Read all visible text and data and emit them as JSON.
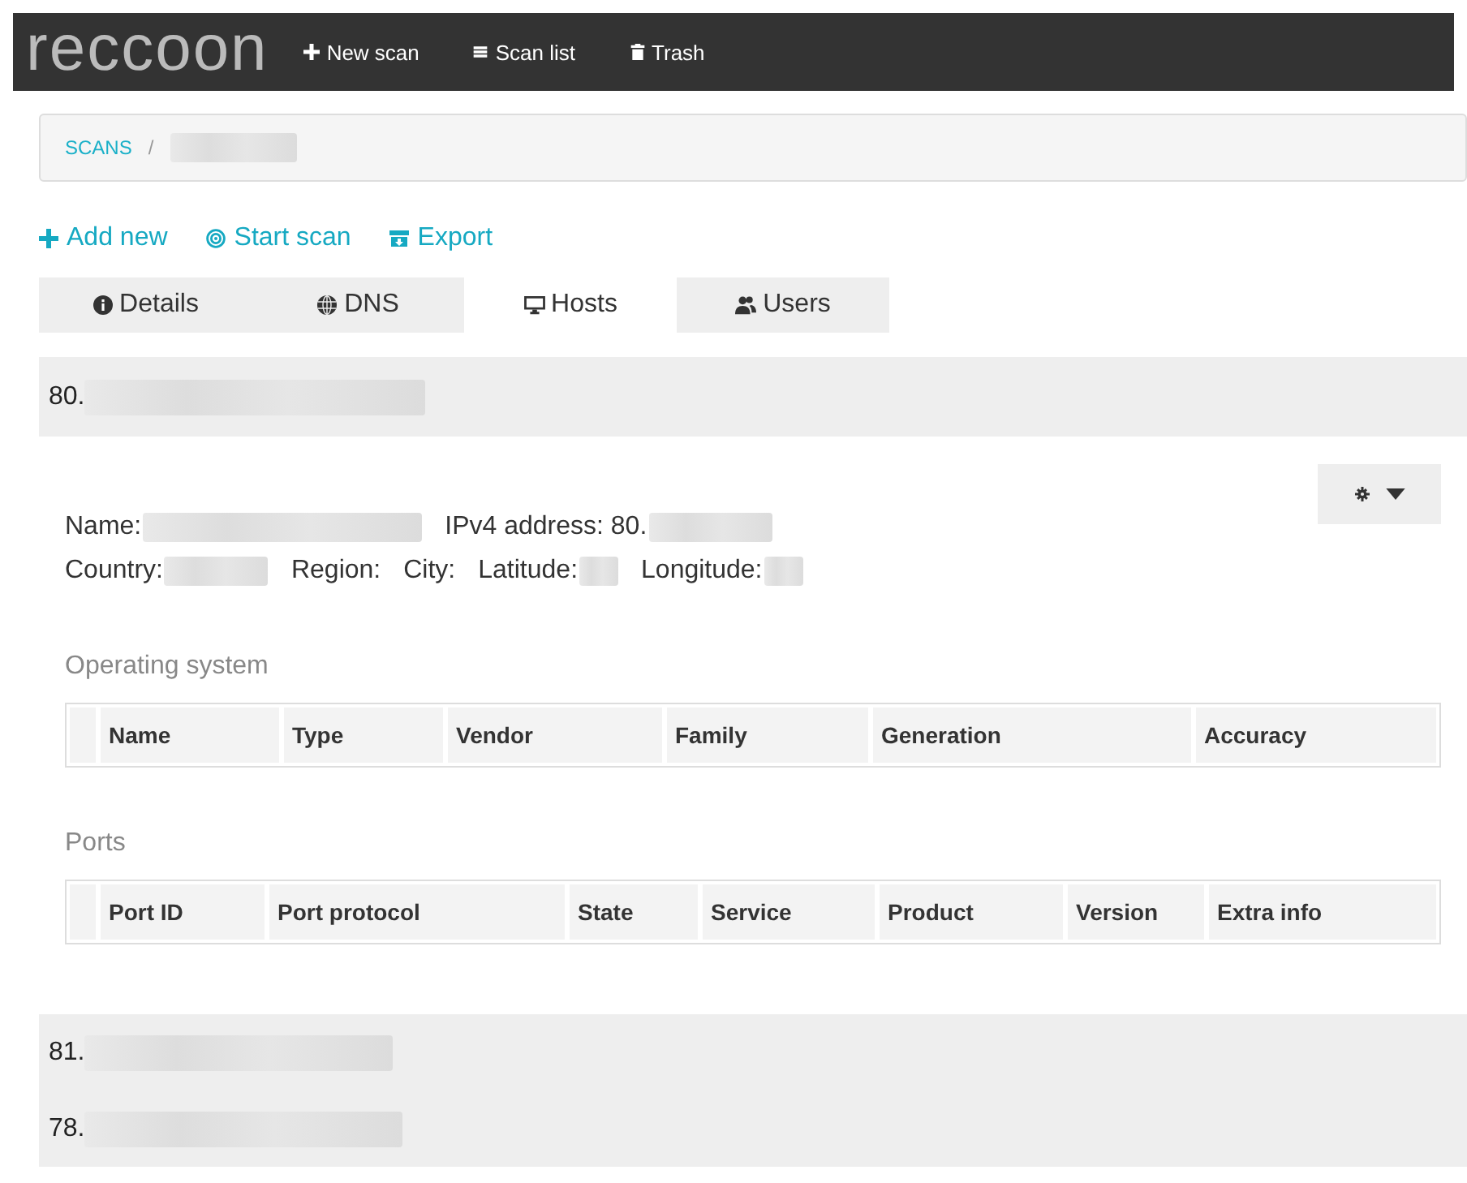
{
  "navbar": {
    "brand": "reccoon",
    "links": [
      {
        "label": "New scan"
      },
      {
        "label": "Scan list"
      },
      {
        "label": "Trash"
      }
    ]
  },
  "breadcrumb": {
    "separator": "/",
    "items": [
      {
        "label": "SCANS",
        "redacted": false
      },
      {
        "redacted": true
      }
    ]
  },
  "actions": [
    {
      "label": "Add new"
    },
    {
      "label": "Start scan"
    },
    {
      "label": "Export"
    }
  ],
  "tabs": [
    {
      "label": "Details",
      "selected": false
    },
    {
      "label": "DNS",
      "selected": false
    },
    {
      "label": "Hosts",
      "selected": true
    },
    {
      "label": "Users",
      "selected": false
    }
  ],
  "hosts": [
    {
      "address": "80.",
      "expanded": true,
      "field_rows": [
        {
          "fields": [
            {
              "label": "Name:",
              "redacted": true
            },
            {
              "label": "IPv4 address: 80.",
              "redacted": true
            }
          ]
        },
        {
          "fields": [
            {
              "label": "Country:",
              "redacted": true
            },
            {
              "label": "Region:",
              "redacted": false
            },
            {
              "label": "City:",
              "redacted": false
            },
            {
              "label": "Latitude:",
              "redacted": true
            },
            {
              "label": "Longitude:",
              "redacted": true
            }
          ]
        }
      ],
      "sections": [
        {
          "title": "Operating system",
          "columns": [
            "Name",
            "Type",
            "Vendor",
            "Family",
            "Generation",
            "Accuracy"
          ]
        },
        {
          "title": "Ports",
          "columns": [
            "Port ID",
            "Port protocol",
            "State",
            "Service",
            "Product",
            "Version",
            "Extra info"
          ]
        }
      ]
    },
    {
      "address": "81.",
      "expanded": false
    },
    {
      "address": "78.",
      "expanded": false
    }
  ]
}
